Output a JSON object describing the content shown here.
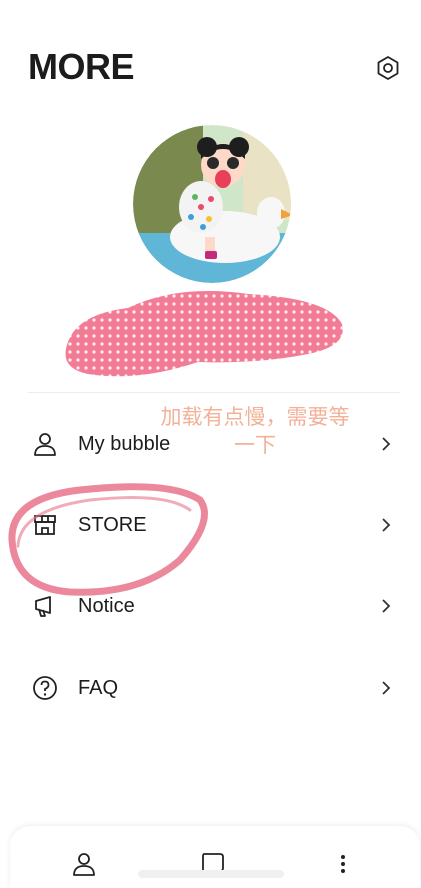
{
  "header": {
    "title": "MORE",
    "settings_icon": "settings-gear-icon"
  },
  "profile": {
    "avatar_icon": "profile-avatar-image"
  },
  "overlay_note": {
    "line1": "加载有点慢，需要等",
    "line2": "一下"
  },
  "menu": {
    "items": [
      {
        "label": "My bubble",
        "icon": "person-icon"
      },
      {
        "label": "STORE",
        "icon": "store-icon"
      },
      {
        "label": "Notice",
        "icon": "megaphone-icon"
      },
      {
        "label": "FAQ",
        "icon": "question-circle-icon"
      }
    ]
  },
  "bottom_nav": {
    "items": [
      "person-icon",
      "chat-bubble-icon",
      "more-vertical-icon"
    ]
  },
  "colors": {
    "accent_annotation": "#e8738a",
    "redaction_pink": "#f27b96",
    "note_orange": "#f2a98c"
  }
}
